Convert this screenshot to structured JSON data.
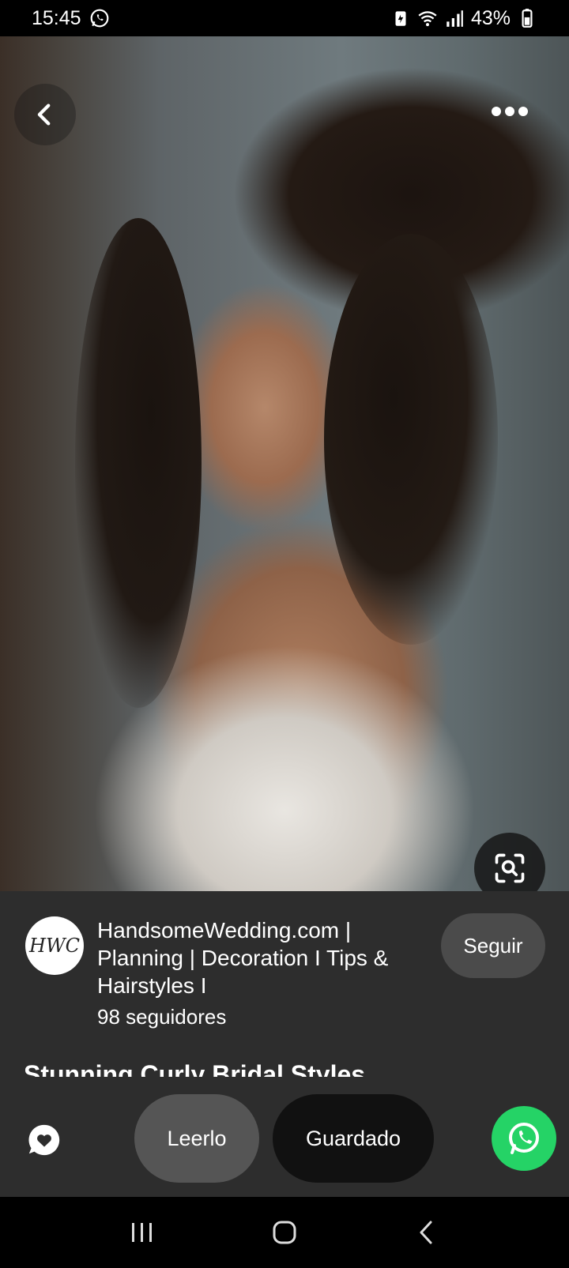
{
  "status_bar": {
    "time": "15:45",
    "battery": "43%",
    "icons": [
      "whatsapp-notification-icon",
      "battery-saver-icon",
      "wifi-icon",
      "signal-icon",
      "battery-icon"
    ]
  },
  "hero": {
    "icons": [
      "back-arrow-icon",
      "more-dots-icon",
      "visual-search-icon"
    ]
  },
  "creator": {
    "avatar_text": "HWC",
    "name": "HandsomeWedding.com | Planning | Decoration I Tips & Hairstyles I",
    "followers": "98 seguidores",
    "follow_label": "Seguir"
  },
  "pin": {
    "title": "Stunning Curly Bridal Styles"
  },
  "actions": {
    "read_label": "Leerlo",
    "saved_label": "Guardado",
    "icons": [
      "comment-heart-icon",
      "whatsapp-icon"
    ]
  },
  "nav": {
    "icons": [
      "recent-apps-icon",
      "home-icon",
      "back-icon"
    ]
  },
  "colors": {
    "panel": "#2d2d2d",
    "whatsapp": "#25d366",
    "saved_button": "#111111",
    "read_button": "#555555"
  }
}
